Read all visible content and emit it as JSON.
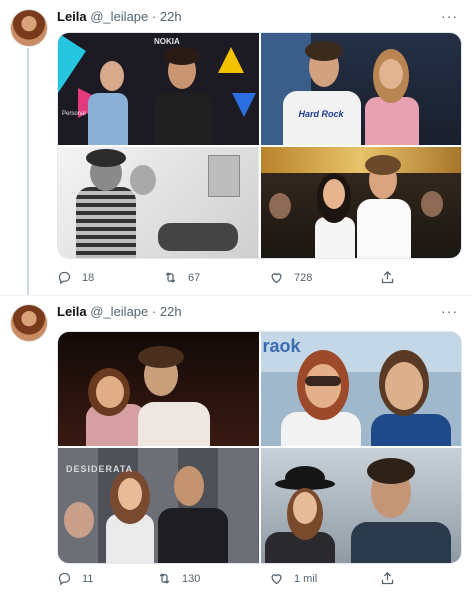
{
  "tweets": [
    {
      "author": {
        "name": "Leila",
        "handle": "@_leilape",
        "time": "22h"
      },
      "dot": "·",
      "counts": {
        "replies": "18",
        "retweets": "67",
        "likes": "728"
      },
      "photos": [
        {
          "caption": "NOKIA",
          "caption2": "Personal"
        },
        {
          "caption": "Hard Rock"
        },
        {
          "caption": ""
        },
        {
          "caption": ""
        }
      ]
    },
    {
      "author": {
        "name": "Leila",
        "handle": "@_leilape",
        "time": "22h"
      },
      "dot": "·",
      "counts": {
        "replies": "11",
        "retweets": "130",
        "likes": "1 mil"
      },
      "photos": [
        {
          "caption": ""
        },
        {
          "caption": "raok"
        },
        {
          "caption": "DESIDERATA"
        },
        {
          "caption": ""
        }
      ]
    }
  ],
  "icons": {
    "more": "···",
    "reply": "reply-icon",
    "retweet": "retweet-icon",
    "like": "heart-icon",
    "share": "share-icon"
  }
}
